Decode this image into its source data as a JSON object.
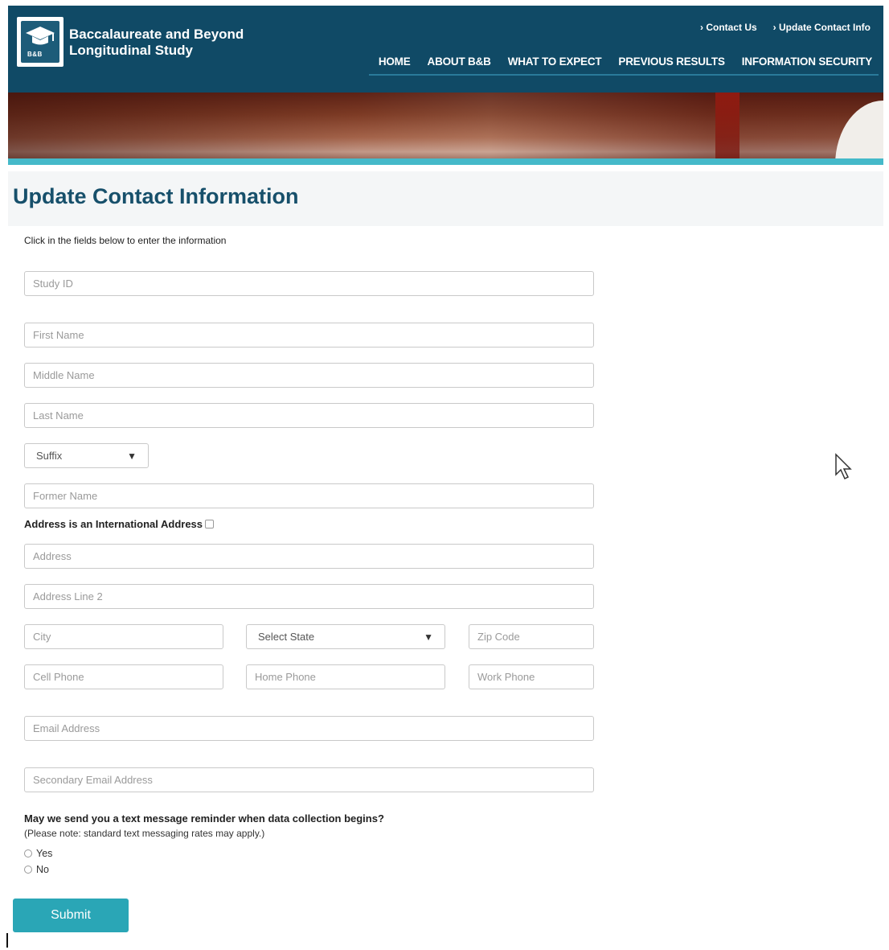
{
  "header": {
    "logo_tag": "B&B",
    "brand_line1": "Baccalaureate and Beyond",
    "brand_line2": "Longitudinal Study",
    "util_links": [
      "› Contact Us",
      "› Update Contact Info"
    ],
    "nav": [
      "HOME",
      "ABOUT B&B",
      "WHAT TO EXPECT",
      "PREVIOUS RESULTS",
      "INFORMATION SECURITY"
    ]
  },
  "page": {
    "title": "Update Contact Information",
    "instructions": "Click in the fields below to enter the information"
  },
  "form": {
    "study_id": "Study ID",
    "first_name": "First Name",
    "middle_name": "Middle Name",
    "last_name": "Last Name",
    "suffix": "Suffix",
    "former_name": "Former Name",
    "intl_label": "Address is an International Address",
    "address": "Address",
    "address2": "Address Line 2",
    "city": "City",
    "state": "Select State",
    "zip": "Zip Code",
    "cell": "Cell Phone",
    "home": "Home Phone",
    "work": "Work Phone",
    "email": "Email Address",
    "email2": "Secondary Email Address",
    "sms_question": "May we send you a text message reminder when data collection begins?",
    "sms_note": "(Please note: standard text messaging rates may apply.)",
    "yes": "Yes",
    "no": "No",
    "submit": "Submit"
  },
  "colors": {
    "header_bg": "#104a66",
    "accent": "#2aa6b6",
    "title": "#17506b"
  }
}
